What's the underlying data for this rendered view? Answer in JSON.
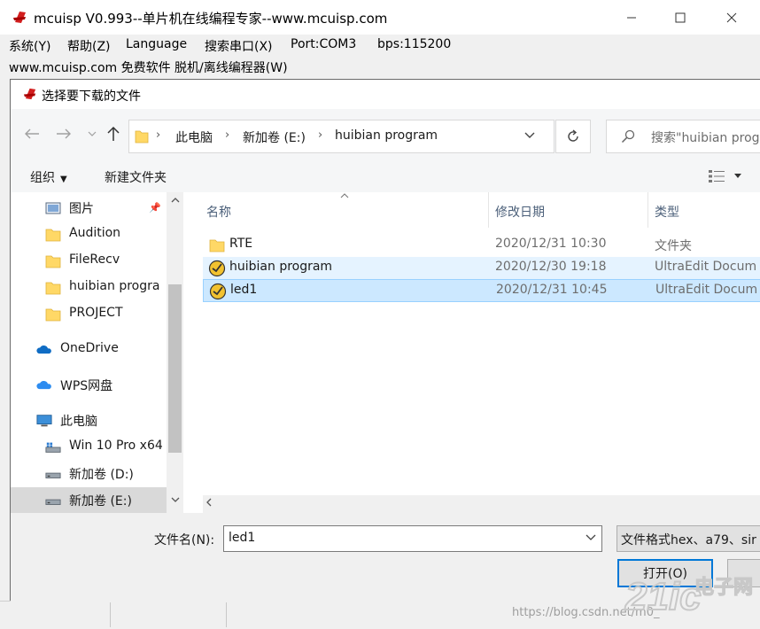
{
  "app": {
    "title": "mcuisp V0.993--单片机在线编程专家--www.mcuisp.com",
    "menu": [
      "系统(Y)",
      "帮助(Z)",
      "Language",
      "搜索串口(X)",
      "Port:COM3",
      "bps:115200"
    ],
    "subbar": "www.mcuisp.com 免费软件 脱机/离线编程器(W)"
  },
  "dialog": {
    "title": "选择要下载的文件",
    "breadcrumb": [
      "此电脑",
      "新加卷 (E:)",
      "huibian program"
    ],
    "search_placeholder": "搜索\"huibian program\"",
    "toolbar": {
      "organize": "组织",
      "new_folder": "新建文件夹"
    },
    "nav_items": [
      {
        "label": "图片",
        "icon": "pictures-icon",
        "pinned": true
      },
      {
        "label": "Audition",
        "icon": "folder-icon"
      },
      {
        "label": "FileRecv",
        "icon": "folder-icon"
      },
      {
        "label": "huibian progra",
        "icon": "folder-icon"
      },
      {
        "label": "PROJECT",
        "icon": "folder-icon"
      },
      {
        "label": "OneDrive",
        "icon": "onedrive-icon"
      },
      {
        "label": "WPS网盘",
        "icon": "wps-cloud-icon"
      },
      {
        "label": "此电脑",
        "icon": "computer-icon"
      },
      {
        "label": "Win 10 Pro x64",
        "icon": "drive-icon"
      },
      {
        "label": "新加卷 (D:)",
        "icon": "drive-icon"
      },
      {
        "label": "新加卷 (E:)",
        "icon": "drive-icon",
        "selected": true
      }
    ],
    "columns": {
      "name": "名称",
      "date": "修改日期",
      "type": "类型"
    },
    "files": [
      {
        "name": "RTE",
        "date": "2020/12/31 10:30",
        "type": "文件夹",
        "icon": "folder-icon",
        "state": "normal"
      },
      {
        "name": "huibian program",
        "date": "2020/12/30 19:18",
        "type": "UltraEdit Docum",
        "icon": "ultraedit-icon",
        "state": "hover"
      },
      {
        "name": "led1",
        "date": "2020/12/31 10:45",
        "type": "UltraEdit Docum",
        "icon": "ultraedit-icon",
        "state": "selected"
      }
    ],
    "filename_label": "文件名(N):",
    "filename_value": "led1",
    "filter_value": "文件格式hex、a79、sir",
    "open_button": "打开(O)"
  },
  "watermark": {
    "url": "https://blog.csdn.net/m0_",
    "logo": "21ic电子网"
  },
  "colors": {
    "accent": "#0078d7",
    "selection": "#cce8ff",
    "hover": "#e5f3ff",
    "folder": "#ffd866",
    "logo_red": "#cc0000"
  }
}
